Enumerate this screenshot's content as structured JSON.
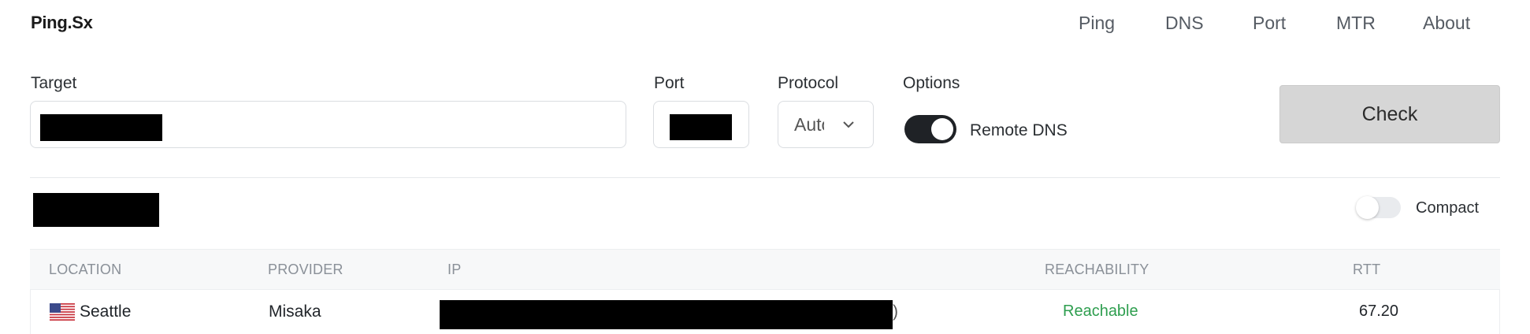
{
  "brand": "Ping.Sx",
  "nav": [
    "Ping",
    "DNS",
    "Port",
    "MTR",
    "About"
  ],
  "form": {
    "target_label": "Target",
    "port_label": "Port",
    "protocol_label": "Protocol",
    "protocol_value": "Auto",
    "options_label": "Options",
    "remote_dns_label": "Remote DNS",
    "remote_dns_on": true,
    "check_label": "Check"
  },
  "results": {
    "compact_label": "Compact",
    "compact_on": false,
    "columns": [
      "LOCATION",
      "PROVIDER",
      "IP",
      "REACHABILITY",
      "RTT"
    ],
    "rows": [
      {
        "location": "Seattle",
        "flag": "us-flag-icon",
        "provider": "Misaka",
        "ip_suffix": ")",
        "reachability": "Reachable",
        "rtt": "67.20"
      }
    ]
  },
  "colors": {
    "reachable": "#2e9e4f",
    "check_bg": "#d6d6d6",
    "toggle_on": "#1f2226"
  }
}
